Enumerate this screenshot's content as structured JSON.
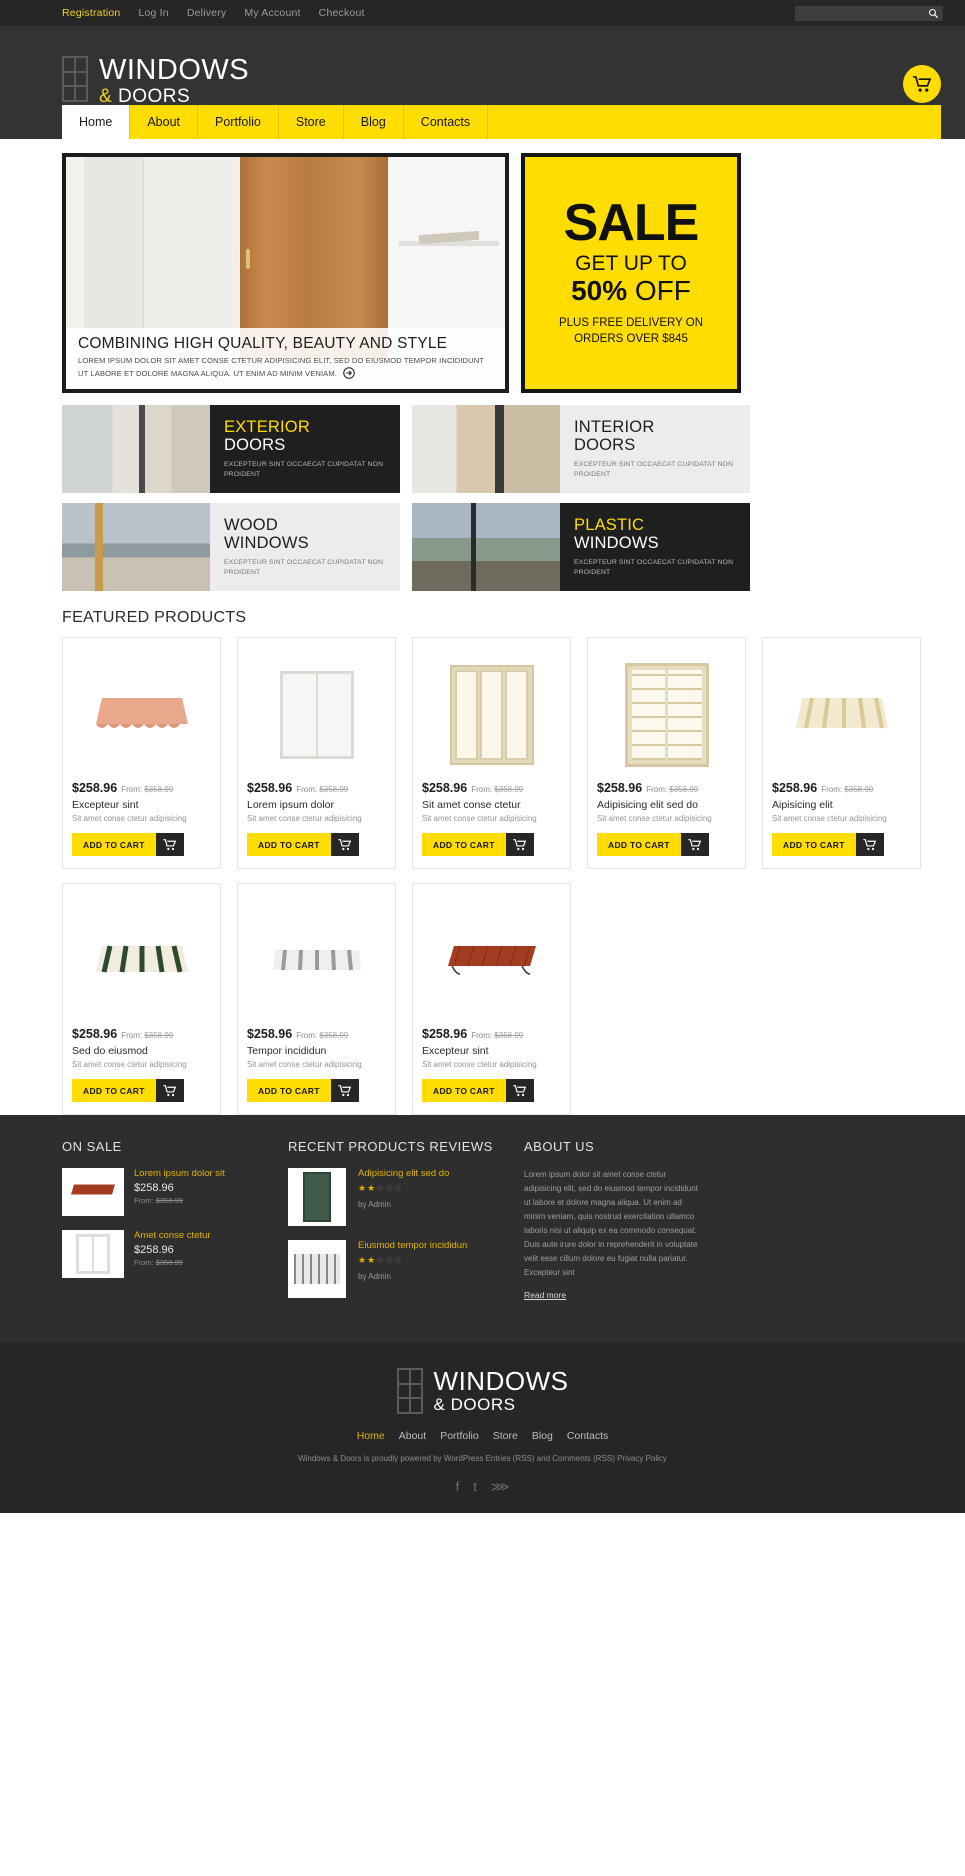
{
  "topbar": {
    "links": [
      {
        "label": "Registration",
        "active": true
      },
      {
        "label": "Log In",
        "active": false
      },
      {
        "label": "Delivery",
        "active": false
      },
      {
        "label": "My Account",
        "active": false
      },
      {
        "label": "Checkout",
        "active": false
      }
    ],
    "search": {
      "value": "",
      "placeholder": "",
      "icon": "search-icon"
    }
  },
  "header": {
    "logo": {
      "line1": "WINDOWS",
      "amp": "&",
      "line2": "DOORS"
    },
    "cart_icon": "shopping-cart-icon"
  },
  "nav": {
    "items": [
      {
        "label": "Home",
        "active": true
      },
      {
        "label": "About",
        "active": false
      },
      {
        "label": "Portfolio",
        "active": false
      },
      {
        "label": "Store",
        "active": false
      },
      {
        "label": "Blog",
        "active": false
      },
      {
        "label": "Contacts",
        "active": false
      }
    ]
  },
  "hero": {
    "slide": {
      "title": "COMBINING HIGH QUALITY, BEAUTY AND STYLE",
      "text": "LOREM IPSUM DOLOR SIT AMET CONSE CTETUR ADIPISICING ELIT, SED DO EIUSMOD TEMPOR INCIDIDUNT UT LABORE ET DOLORE MAGNA ALIQUA. UT ENIM AD MINIM VENIAM.",
      "more_icon": "arrow-right-circle-icon"
    },
    "sale": {
      "word": "SALE",
      "get_up_to": "GET UP TO",
      "percent": "50%",
      "off": "OFF",
      "note": "PLUS FREE DELIVERY ON ORDERS OVER $845"
    }
  },
  "categories": [
    {
      "title": "EXTERIOR",
      "subtitle": "DOORS",
      "text": "EXCEPTEUR SINT OCCAECAT CUPIDATAT NON PROIDENT",
      "theme": "dark",
      "photo": "exterior-doors-photo"
    },
    {
      "title": "INTERIOR",
      "subtitle": "DOORS",
      "text": "EXCEPTEUR SINT OCCAECAT CUPIDATAT NON PROIDENT",
      "theme": "light",
      "photo": "interior-doors-photo"
    },
    {
      "title": "WOOD",
      "subtitle": "WINDOWS",
      "text": "EXCEPTEUR SINT OCCAECAT CUPIDATAT NON PROIDENT",
      "theme": "light",
      "photo": "wood-windows-photo"
    },
    {
      "title": "PLASTIC",
      "subtitle": "WINDOWS",
      "text": "EXCEPTEUR SINT OCCAECAT CUPIDATAT NON PROIDENT",
      "theme": "dark",
      "photo": "plastic-windows-photo"
    }
  ],
  "featured": {
    "heading": "FEATURED PRODUCTS",
    "add_to_cart_label": "ADD TO CART",
    "cart_icon": "cart-icon",
    "from_label": "From:",
    "products": [
      {
        "price": "$258.96",
        "old_price": "$358.99",
        "name": "Excepteur sint",
        "desc": "Sit amet conse ctetur adipisicing",
        "art": "awning-pink"
      },
      {
        "price": "$258.96",
        "old_price": "$358.99",
        "name": "Lorem ipsum dolor",
        "desc": "Sit amet conse ctetur adipisicing",
        "art": "window-white"
      },
      {
        "price": "$258.96",
        "old_price": "$358.99",
        "name": "Sit amet conse ctetur",
        "desc": "Sit amet conse ctetur adipisicing",
        "art": "door-beige"
      },
      {
        "price": "$258.96",
        "old_price": "$358.99",
        "name": "Adipisicing elit sed do",
        "desc": "Sit amet conse ctetur adipisicing",
        "art": "french-door"
      },
      {
        "price": "$258.96",
        "old_price": "$358.99",
        "name": "Aipisicing elit",
        "desc": "Sit amet conse ctetur adipisicing",
        "art": "awning-cream-stripe"
      },
      {
        "price": "$258.96",
        "old_price": "$358.99",
        "name": "Sed do eiusmod",
        "desc": "Sit amet conse ctetur adipisicing",
        "art": "awning-green-stripe"
      },
      {
        "price": "$258.96",
        "old_price": "$358.99",
        "name": "Tempor incididun",
        "desc": "Sit amet conse ctetur adipisicing",
        "art": "awning-grey-stripe"
      },
      {
        "price": "$258.96",
        "old_price": "$358.99",
        "name": "Excepteur sint",
        "desc": "Sit amet conse ctetur adipisicing",
        "art": "awning-wood-red"
      }
    ]
  },
  "widgets": {
    "on_sale": {
      "heading": "ON SALE",
      "from_label": "From:",
      "items": [
        {
          "name": "Lorem ipsum dolor sit",
          "price": "$258.96",
          "old_price": "$358.99",
          "art": "awning-wood-red"
        },
        {
          "name": "Amet conse ctetur",
          "price": "$258.96",
          "old_price": "$358.99",
          "art": "window-white"
        }
      ]
    },
    "reviews": {
      "heading": "RECENT PRODUCTS REVIEWS",
      "items": [
        {
          "name": "Adipisicing elit sed do",
          "rating": 2.5,
          "author": "by Admin",
          "art": "green-door"
        },
        {
          "name": "Eiusmod tempor incididun",
          "rating": 2.5,
          "author": "by Admin",
          "art": "grid-window"
        }
      ]
    },
    "about": {
      "heading": "ABOUT US",
      "text": "Lorem ipsum dolor sit amet conse ctetur adipisicing elit, sed do eiusmod tempor incididunt ut labore et dolore magna aliqua. Ut enim ad minim veniam, quis nostrud exercitation ullamco laboris nisi ut aliquip ex ea commodo consequat. Duis aute irure dolor in reprehenderit in voluptate velit esse cillum dolore eu fugiat nulla pariatur. Excepteur sint",
      "read_more": "Read more"
    }
  },
  "footer": {
    "logo": {
      "line1": "WINDOWS",
      "amp": "&",
      "line2": "DOORS"
    },
    "nav": [
      {
        "label": "Home",
        "active": true
      },
      {
        "label": "About",
        "active": false
      },
      {
        "label": "Portfolio",
        "active": false
      },
      {
        "label": "Store",
        "active": false
      },
      {
        "label": "Blog",
        "active": false
      },
      {
        "label": "Contacts",
        "active": false
      }
    ],
    "copyright": "Windows & Doors is proudly powered by WordPress Entries (RSS) and Comments (RSS) Privacy Policy",
    "social": [
      "facebook-icon",
      "twitter-icon",
      "rss-icon"
    ]
  },
  "colors": {
    "accent": "#ffdd00",
    "dark": "#262626",
    "header": "#333333",
    "link": "#e0b400"
  }
}
